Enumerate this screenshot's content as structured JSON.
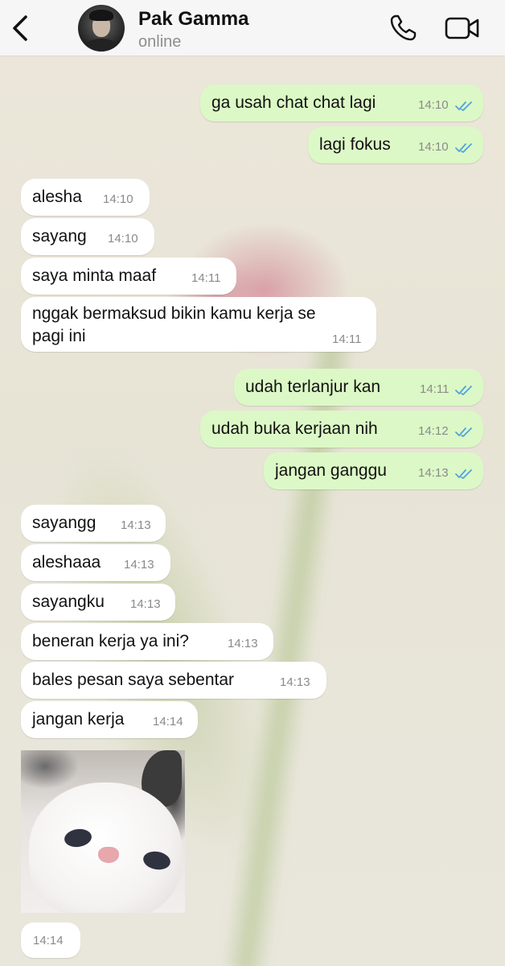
{
  "header": {
    "contact_name": "Pak Gamma",
    "status": "online"
  },
  "messages": [
    {
      "dir": "out",
      "text": "ga usah chat chat lagi",
      "time": "14:10",
      "read": true
    },
    {
      "dir": "out",
      "text": "lagi fokus",
      "time": "14:10",
      "read": true
    },
    {
      "dir": "in",
      "text": "alesha",
      "time": "14:10"
    },
    {
      "dir": "in",
      "text": "sayang",
      "time": "14:10"
    },
    {
      "dir": "in",
      "text": "saya minta maaf",
      "time": "14:11"
    },
    {
      "dir": "in",
      "text": "nggak bermaksud bikin kamu kerja se pagi ini",
      "line1": "nggak bermaksud bikin kamu kerja se",
      "line2": "pagi ini",
      "time": "14:11"
    },
    {
      "dir": "out",
      "text": "udah terlanjur kan",
      "time": "14:11",
      "read": true
    },
    {
      "dir": "out",
      "text": "udah buka kerjaan nih",
      "time": "14:12",
      "read": true
    },
    {
      "dir": "out",
      "text": "jangan ganggu",
      "time": "14:13",
      "read": true
    },
    {
      "dir": "in",
      "text": "sayangg",
      "time": "14:13"
    },
    {
      "dir": "in",
      "text": "aleshaaa",
      "time": "14:13"
    },
    {
      "dir": "in",
      "text": "sayangku",
      "time": "14:13"
    },
    {
      "dir": "in",
      "text": "beneran kerja ya ini?",
      "time": "14:13"
    },
    {
      "dir": "in",
      "text": "bales pesan saya sebentar",
      "time": "14:13"
    },
    {
      "dir": "in",
      "text": "jangan kerja",
      "time": "14:14"
    },
    {
      "dir": "in",
      "type": "image",
      "image": "white-cat-photo",
      "time": "14:14"
    }
  ],
  "colors": {
    "outgoing_bubble": "#dcf8c6",
    "incoming_bubble": "#ffffff",
    "read_ticks": "#4fa3e0"
  },
  "icons": {
    "back": "chevron-left-icon",
    "call": "phone-icon",
    "video": "video-camera-icon",
    "read": "double-check-icon"
  }
}
